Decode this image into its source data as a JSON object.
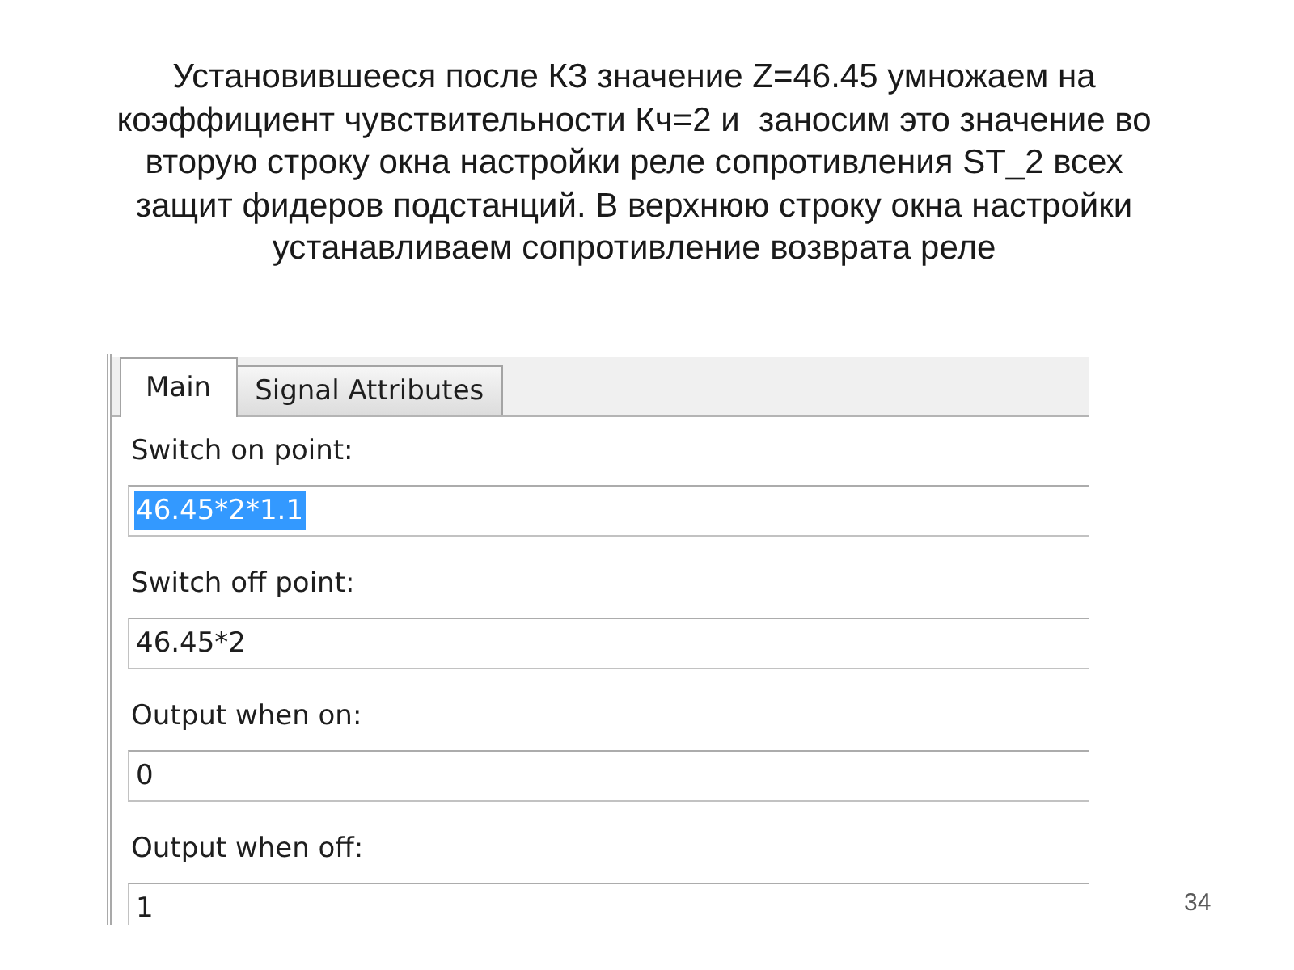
{
  "caption": "Установившееся после КЗ значение Z=46.45 умножаем на\nкоэффициент чувствительности Кч=2 и  заносим это значение во\nвторую строку окна настройки реле сопротивления ST_2 всех\nзащит фидеров подстанций. В верхнюю строку окна настройки\nустанавливаем сопротивление возврата реле",
  "dialog": {
    "tabs": [
      {
        "label": "Main",
        "selected": true
      },
      {
        "label": "Signal Attributes",
        "selected": false
      }
    ],
    "fields": [
      {
        "label": "Switch on point:",
        "value": "46.45*2*1.1",
        "highlighted": true
      },
      {
        "label": "Switch off point:",
        "value": "46.45*2",
        "highlighted": false
      },
      {
        "label": "Output when on:",
        "value": "0",
        "highlighted": false
      },
      {
        "label": "Output when off:",
        "value": "1",
        "highlighted": false
      }
    ]
  },
  "page_number": "34"
}
